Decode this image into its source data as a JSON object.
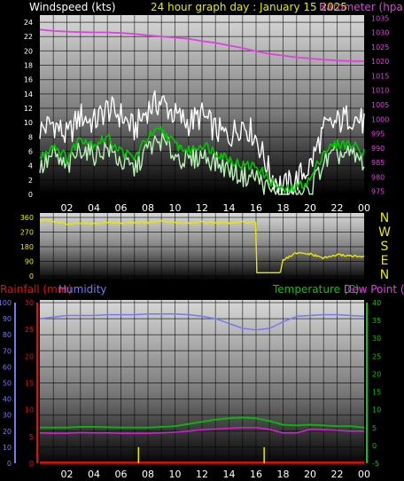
{
  "header": {
    "windspeed_label": "Windspeed (kts)",
    "graph_title": "24 hour graph day :  January 15 2025",
    "barometer_label": "Barometer (hpa)",
    "rainfall_label": "Rainfall (mm)",
    "humidity_label": "Humidity",
    "temperature_label": "Temperature (C)",
    "dewpoint_label": "Dew Point (C)"
  },
  "compass": [
    "N",
    "W",
    "S",
    "E",
    "N"
  ],
  "colors": {
    "windspeed": "#ffffff",
    "wind_avg": "#00c800",
    "wind_band": "#b8f0b8",
    "barometer": "#e040e0",
    "winddir": "#e8e800",
    "rainfall": "#e01010",
    "humidity": "#7878f0",
    "temperature": "#10b010",
    "dewpoint": "#d020d0"
  },
  "chart_data": [
    {
      "type": "line",
      "xlabel": "",
      "x_ticks": [
        "02",
        "04",
        "06",
        "08",
        "10",
        "12",
        "14",
        "16",
        "18",
        "20",
        "22",
        "00"
      ],
      "y_left": {
        "label": "Windspeed (kts)",
        "ylim": [
          0,
          25
        ],
        "ticks": [
          0,
          2,
          4,
          6,
          8,
          10,
          12,
          14,
          16,
          18,
          20,
          22,
          24
        ]
      },
      "y_right": {
        "label": "Barometer (hpa)",
        "ylim": [
          974,
          1036
        ],
        "ticks": [
          975,
          980,
          985,
          990,
          995,
          1000,
          1005,
          1010,
          1015,
          1020,
          1025,
          1030,
          1035
        ]
      },
      "x_hours": [
        0,
        1,
        2,
        3,
        4,
        5,
        6,
        7,
        8,
        9,
        10,
        11,
        12,
        13,
        14,
        15,
        16,
        17,
        18,
        19,
        20,
        21,
        22,
        23,
        24
      ],
      "series": [
        {
          "axis": "left",
          "values_gust": [
            9,
            10,
            8,
            11,
            10,
            12,
            11,
            9,
            12,
            13,
            11,
            10,
            11,
            9,
            8,
            10,
            8,
            3,
            1,
            2,
            4,
            9,
            10,
            11,
            10
          ]
        },
        {
          "axis": "left",
          "values_avg": [
            5,
            7,
            5,
            8,
            7,
            8,
            6,
            5,
            8,
            9,
            7,
            6,
            7,
            6,
            5,
            4,
            4,
            2,
            0.5,
            1,
            2,
            6,
            7,
            7,
            6
          ]
        },
        {
          "axis": "right",
          "values_baro": [
            1031,
            1030.5,
            1030.3,
            1030.1,
            1030,
            1030,
            1029.8,
            1029.5,
            1029,
            1028.6,
            1028.2,
            1027.8,
            1027,
            1026.4,
            1025.5,
            1024.6,
            1023.5,
            1022.6,
            1022,
            1021.4,
            1021,
            1020.6,
            1020.3,
            1020.1,
            1020
          ]
        }
      ]
    },
    {
      "type": "line",
      "ylim": [
        0,
        360
      ],
      "ticks": [
        0,
        90,
        180,
        270,
        360
      ],
      "x_hours": [
        0,
        0.5,
        1,
        1.5,
        2,
        3,
        4,
        5,
        6,
        7,
        8,
        9,
        10,
        11,
        12,
        13,
        14,
        15,
        16,
        16.01,
        17,
        17.8,
        18,
        18.5,
        19,
        20,
        21,
        22,
        23,
        24
      ],
      "values": [
        340,
        345,
        335,
        330,
        318,
        325,
        322,
        330,
        325,
        330,
        328,
        335,
        330,
        325,
        330,
        328,
        325,
        330,
        330,
        20,
        20,
        20,
        95,
        120,
        140,
        135,
        110,
        130,
        125,
        115
      ]
    },
    {
      "type": "line",
      "x_ticks": [
        "02",
        "04",
        "06",
        "08",
        "10",
        "12",
        "14",
        "16",
        "18",
        "20",
        "22",
        "00"
      ],
      "y_rain": {
        "label": "Rainfall (mm)",
        "ylim": [
          0,
          30
        ],
        "ticks": [
          0,
          5,
          10,
          15,
          20,
          25,
          30
        ]
      },
      "y_humidity": {
        "label": "Humidity",
        "ylim": [
          0,
          100
        ],
        "ticks": [
          0,
          10,
          20,
          30,
          40,
          50,
          60,
          70,
          80,
          90,
          100
        ]
      },
      "y_temp": {
        "label": "Temperature (C)",
        "ylim": [
          -5,
          40
        ],
        "ticks": [
          -5,
          0,
          5,
          10,
          15,
          20,
          25,
          30,
          35,
          40
        ]
      },
      "x_hours": [
        0,
        1,
        2,
        3,
        4,
        5,
        6,
        7,
        8,
        9,
        10,
        11,
        12,
        13,
        14,
        15,
        16,
        17,
        18,
        19,
        20,
        21,
        22,
        23,
        24
      ],
      "series": [
        {
          "name": "Humidity",
          "values": [
            90,
            91,
            92,
            92,
            92,
            92.5,
            92.5,
            92.5,
            93,
            93,
            93,
            92.5,
            91.5,
            90,
            87,
            84,
            83,
            84,
            88,
            91.5,
            92,
            92.5,
            92.5,
            92,
            91.5
          ]
        },
        {
          "name": "Temperature",
          "values": [
            5,
            5,
            5,
            5.2,
            5.2,
            5.1,
            5,
            5,
            5,
            5.2,
            5.4,
            6,
            6.6,
            7.2,
            7.6,
            7.8,
            7.6,
            6.8,
            5.8,
            5.6,
            5.8,
            5.6,
            5.4,
            5.4,
            5
          ]
        },
        {
          "name": "Dew Point",
          "values": [
            3.5,
            3.4,
            3.4,
            3.6,
            3.5,
            3.5,
            3.4,
            3.4,
            3.4,
            3.5,
            3.7,
            4,
            4.4,
            4.6,
            4.8,
            5,
            5,
            4.5,
            3.5,
            3.5,
            4.5,
            4.4,
            4.2,
            4,
            4
          ]
        },
        {
          "name": "Rainfall",
          "values": [
            0.1,
            0.1,
            0.1,
            0.1,
            0.1,
            0.1,
            0.1,
            0.1,
            0.1,
            0.1,
            0.1,
            0.1,
            0.1,
            0.1,
            0.1,
            0.1,
            0.1,
            0.1,
            0.1,
            0.1,
            0.1,
            0.1,
            0.1,
            0.1,
            0.1
          ]
        }
      ],
      "rain_markers_hours": [
        7.3,
        16.6
      ]
    }
  ]
}
